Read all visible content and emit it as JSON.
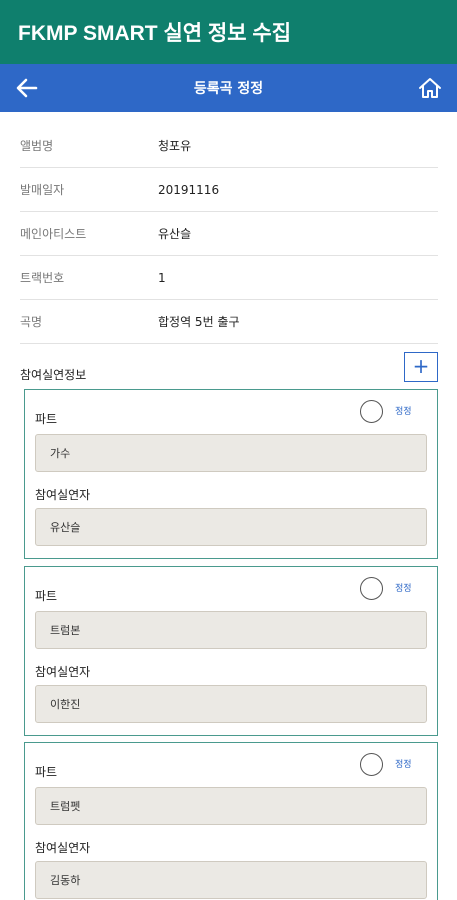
{
  "app": {
    "title": "FKMP SMART 실연 정보 수집"
  },
  "nav": {
    "title": "등록곡 정정",
    "back_icon": "arrow-left-icon",
    "home_icon": "home-icon"
  },
  "colors": {
    "header_bg": "#0f7f6d",
    "nav_bg": "#2e68c7",
    "card_border": "#4a9a8e",
    "field_bg": "#ebe9e4"
  },
  "info": [
    {
      "label": "앨범명",
      "value": "청포유"
    },
    {
      "label": "발매일자",
      "value": "20191116"
    },
    {
      "label": "메인아티스트",
      "value": "유산슬"
    },
    {
      "label": "트랙번호",
      "value": "1"
    },
    {
      "label": "곡명",
      "value": "합정역 5번 출구"
    }
  ],
  "participants_section": {
    "title": "참여실연정보",
    "add_label": "+"
  },
  "participants": [
    {
      "part_label": "파트",
      "part_value": "가수",
      "performer_label": "참여실연자",
      "performer_value": "유산슬",
      "edit_label": "정정"
    },
    {
      "part_label": "파트",
      "part_value": "트럼본",
      "performer_label": "참여실연자",
      "performer_value": "이한진",
      "edit_label": "정정"
    },
    {
      "part_label": "파트",
      "part_value": "트럼펫",
      "performer_label": "참여실연자",
      "performer_value": "김동하",
      "edit_label": "정정"
    }
  ]
}
